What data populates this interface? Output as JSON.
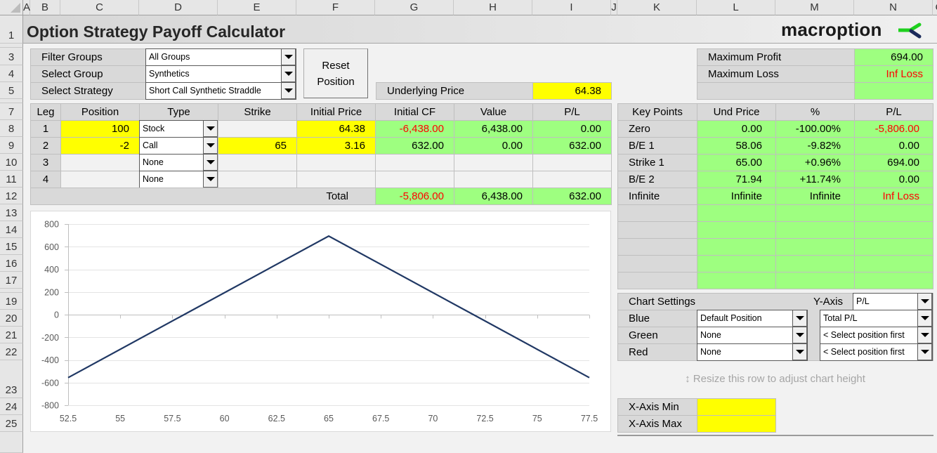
{
  "sheet": {
    "column_headers": [
      "A",
      "B",
      "C",
      "D",
      "E",
      "F",
      "G",
      "H",
      "I",
      "J",
      "K",
      "L",
      "M",
      "N",
      "O"
    ],
    "row_headers": [
      "1",
      "3",
      "4",
      "5",
      "7",
      "8",
      "9",
      "10",
      "11",
      "12",
      "13",
      "14",
      "15",
      "16",
      "17",
      "19",
      "20",
      "21",
      "22",
      "23",
      "24",
      "25"
    ]
  },
  "title": "Option Strategy Payoff Calculator",
  "logo": {
    "text": "macroption",
    "icon": "macroption-arrow-logo"
  },
  "colors": {
    "input_yellow": "#FFFF00",
    "output_green": "#9EFF80",
    "label_gray": "#D9D9D9",
    "negative_red": "#FF0000",
    "series_blue": "#203864",
    "logo_green": "#1ED01E",
    "logo_navy": "#1B2A5A"
  },
  "selectors": [
    {
      "label": "Filter Groups",
      "value": "All Groups"
    },
    {
      "label": "Select Group",
      "value": "Synthetics"
    },
    {
      "label": "Select Strategy",
      "value": "Short Call Synthetic Straddle"
    }
  ],
  "reset_button": {
    "label_line1": "Reset",
    "label_line2": "Position"
  },
  "underlying": {
    "label": "Underlying Price",
    "value": "64.38"
  },
  "summary": [
    {
      "label": "Maximum Profit",
      "value": "694.00"
    },
    {
      "label": "Maximum Loss",
      "value": "Inf Loss"
    },
    {
      "label": "",
      "value": ""
    }
  ],
  "legs": {
    "headers": [
      "Leg",
      "Position",
      "Type",
      "Strike",
      "Initial Price",
      "Initial CF",
      "Value",
      "P/L"
    ],
    "rows": [
      {
        "leg": "1",
        "position": "100",
        "type": "Stock",
        "strike": "",
        "initial_price": "64.38",
        "initial_cf": "-6,438.00",
        "value": "6,438.00",
        "pl": "0.00"
      },
      {
        "leg": "2",
        "position": "-2",
        "type": "Call",
        "strike": "65",
        "initial_price": "3.16",
        "initial_cf": "632.00",
        "value": "0.00",
        "pl": "632.00"
      },
      {
        "leg": "3",
        "position": "",
        "type": "None",
        "strike": "",
        "initial_price": "",
        "initial_cf": "",
        "value": "",
        "pl": ""
      },
      {
        "leg": "4",
        "position": "",
        "type": "None",
        "strike": "",
        "initial_price": "",
        "initial_cf": "",
        "value": "",
        "pl": ""
      }
    ],
    "total": {
      "label": "Total",
      "initial_cf": "-5,806.00",
      "value": "6,438.00",
      "pl": "632.00"
    }
  },
  "key_points": {
    "headers": [
      "Key Points",
      "Und Price",
      "%",
      "P/L"
    ],
    "rows": [
      {
        "name": "Zero",
        "und_price": "0.00",
        "pct": "-100.00%",
        "pl": "-5,806.00"
      },
      {
        "name": "B/E 1",
        "und_price": "58.06",
        "pct": "-9.82%",
        "pl": "0.00"
      },
      {
        "name": "Strike 1",
        "und_price": "65.00",
        "pct": "+0.96%",
        "pl": "694.00"
      },
      {
        "name": "B/E 2",
        "und_price": "71.94",
        "pct": "+11.74%",
        "pl": "0.00"
      },
      {
        "name": "Infinite",
        "und_price": "Infinite",
        "pct": "Infinite",
        "pl": "Inf Loss"
      }
    ]
  },
  "chart_settings": {
    "title": "Chart Settings",
    "y_axis_label": "Y-Axis",
    "y_axis_value": "P/L",
    "rows": [
      {
        "label": "Blue",
        "position": "Default Position",
        "metric": "Total P/L"
      },
      {
        "label": "Green",
        "position": "None",
        "metric": "< Select position first"
      },
      {
        "label": "Red",
        "position": "None",
        "metric": "< Select position first"
      }
    ]
  },
  "resize_hint": "Resize this row to adjust chart height",
  "x_axis_limits": [
    {
      "label": "X-Axis Min",
      "value": ""
    },
    {
      "label": "X-Axis Max",
      "value": ""
    }
  ],
  "chart_data": {
    "type": "line",
    "title": "",
    "xlabel": "",
    "ylabel": "",
    "xlim": [
      52.5,
      77.5
    ],
    "ylim": [
      -800,
      800
    ],
    "x_ticks": [
      52.5,
      55,
      57.5,
      60,
      62.5,
      65,
      67.5,
      70,
      72.5,
      75,
      77.5
    ],
    "x_tick_labels": [
      "52.5",
      "55",
      "57.5",
      "60",
      "62.5",
      "65",
      "67.5",
      "70",
      "72.5",
      "75",
      "77.5"
    ],
    "y_ticks": [
      800,
      600,
      400,
      200,
      0,
      -200,
      -400,
      -600,
      -800
    ],
    "y_tick_labels": [
      "800",
      "600",
      "400",
      "200",
      "0",
      "-200",
      "-400",
      "-600",
      "-800"
    ],
    "grid": true,
    "legend": "none",
    "series": [
      {
        "name": "Total P/L",
        "color": "#203864",
        "x": [
          52.5,
          58.06,
          65,
          71.94,
          77.5
        ],
        "y": [
          -556,
          0,
          694,
          0,
          -556
        ]
      }
    ]
  }
}
